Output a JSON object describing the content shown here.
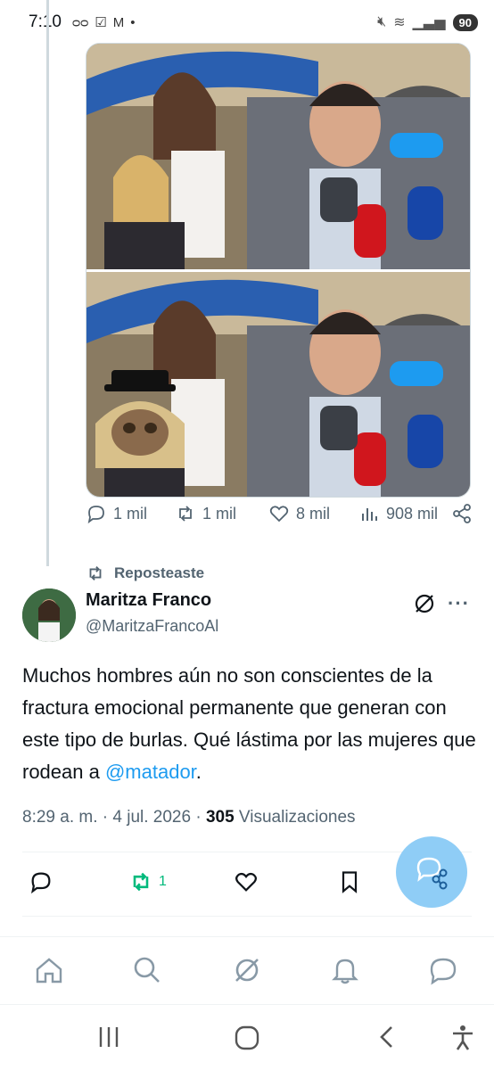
{
  "status_bar": {
    "time": "7:10",
    "battery": "90"
  },
  "media": {
    "top_alt": "Foto",
    "bottom_alt": "Foto"
  },
  "metrics": {
    "replies": "1 mil",
    "reposts": "1 mil",
    "likes": "8 mil",
    "views": "908 mil"
  },
  "repost_header": "Reposteaste",
  "author": {
    "name": "Maritza Franco",
    "handle": "@MaritzaFrancoAl"
  },
  "tweet": {
    "text": "Muchos hombres aún no son conscientes de la fractura emocional permanente que generan con este tipo de burlas. Qué lástima por las mujeres que rodean a ",
    "mention": "@matador",
    "end": ".",
    "time": "8:29 a. m. · 4 jul. 2026 · ",
    "views_count": "305",
    "views_label": " Visualizaciones"
  },
  "actions": {
    "repost_count": "1"
  },
  "colors": {
    "accent": "#1d9bf0",
    "repost_green": "#00ba7c",
    "muted": "#536471"
  }
}
